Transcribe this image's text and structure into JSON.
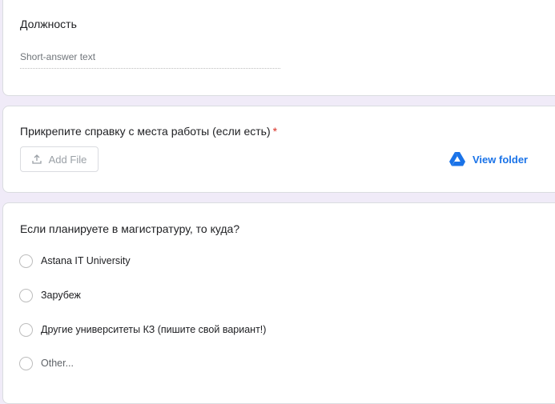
{
  "position_question": {
    "title": "Должность",
    "placeholder": "Short-answer text"
  },
  "file_question": {
    "title": "Прикрепите справку с места работы (если есть)",
    "required_mark": "*",
    "add_file_label": "Add File",
    "view_folder_label": "View folder"
  },
  "masters_question": {
    "title": "Если планируете в магистратуру, то куда?",
    "options": [
      {
        "label": "Astana IT University"
      },
      {
        "label": "Зарубеж"
      },
      {
        "label": "Другие университеты КЗ (пишите свой вариант!)"
      },
      {
        "label": "Other..."
      }
    ]
  },
  "colors": {
    "background": "#f0ebf8",
    "accent": "#1a73e8",
    "required": "#d93025",
    "drive_blue": "#1a73e8"
  },
  "icons": {
    "upload": "upload-icon",
    "drive": "google-drive-icon"
  }
}
